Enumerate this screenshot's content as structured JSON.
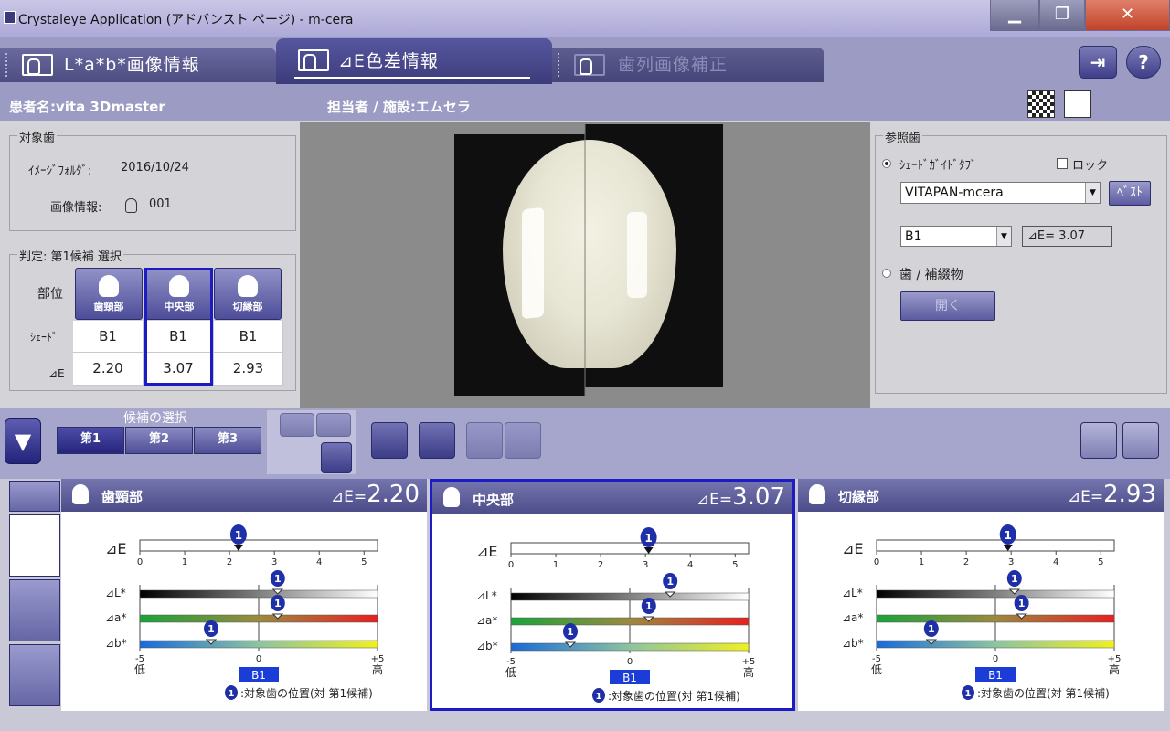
{
  "window": {
    "title": "Crystaleye Application (アドバンスト ページ) - m-cera",
    "min_label": "▁",
    "max_label": "❐",
    "close_label": "✕"
  },
  "tabs": [
    {
      "label": "L*a*b*画像情報"
    },
    {
      "label": "⊿E色差情報"
    },
    {
      "label": "歯列画像補正"
    }
  ],
  "header": {
    "patient": "患者名:vita 3Dmaster",
    "staff": "担当者 / 施設:エムセラ"
  },
  "target": {
    "title": "対象歯",
    "folder_label": "ｲﾒｰｼﾞﾌｫﾙﾀﾞ:",
    "folder_value": "2016/10/24",
    "info_label": "画像情報:",
    "info_value": "001"
  },
  "judgement": {
    "title": "判定: 第1候補 選択",
    "row_part": "部位",
    "row_shade": "ｼｪｰﾄﾞ",
    "row_de": "⊿E",
    "parts": [
      {
        "name": "歯頸部",
        "shade": "B1",
        "de": "2.20"
      },
      {
        "name": "中央部",
        "shade": "B1",
        "de": "3.07"
      },
      {
        "name": "切縁部",
        "shade": "B1",
        "de": "2.93"
      }
    ]
  },
  "reference": {
    "title": "参照歯",
    "opt_shade": "ｼｪｰﾄﾞｶﾞｲﾄﾞﾀﾌﾞ",
    "lock_label": "ロック",
    "guide_value": "VITAPAN-mcera",
    "best_label": "ﾍﾞｽﾄ",
    "shade_value": "B1",
    "de_value": "⊿E= 3.07",
    "opt_tooth": "歯 / 補綴物",
    "open_label": "開く"
  },
  "candidates": {
    "title": "候補の選択",
    "items": [
      "第1",
      "第2",
      "第3"
    ],
    "selected": 0
  },
  "scale": {
    "de_ticks": [
      "0",
      "1",
      "2",
      "3",
      "4",
      "5"
    ],
    "lab_ticks": [
      "-5",
      "0",
      "+5"
    ],
    "low": "低",
    "high": "高",
    "shade": "B1",
    "marker": "1",
    "de_label": "⊿E",
    "l_label": "⊿L*",
    "a_label": "⊿a*",
    "b_label": "⊿b*"
  },
  "cards": [
    {
      "name": "歯頸部",
      "de_prefix": "⊿E=",
      "de": "2.20",
      "values": {
        "de": 2.2,
        "dl": 0.8,
        "da": 0.8,
        "db": -2.0
      },
      "legend": ":対象歯の位置(対 第1候補)"
    },
    {
      "name": "中央部",
      "de_prefix": "⊿E=",
      "de": "3.07",
      "values": {
        "de": 3.07,
        "dl": 1.7,
        "da": 0.8,
        "db": -2.5
      },
      "legend": ":対象歯の位置(対 第1候補)"
    },
    {
      "name": "切縁部",
      "de_prefix": "⊿E=",
      "de": "2.93",
      "values": {
        "de": 2.93,
        "dl": 0.8,
        "da": 1.1,
        "db": -2.7
      },
      "legend": ":対象歯の位置(対 第1候補)"
    }
  ],
  "colors": {
    "accent": "#1c1cc2",
    "panel": "#d4d4d8",
    "header": "#9b9bc4"
  }
}
